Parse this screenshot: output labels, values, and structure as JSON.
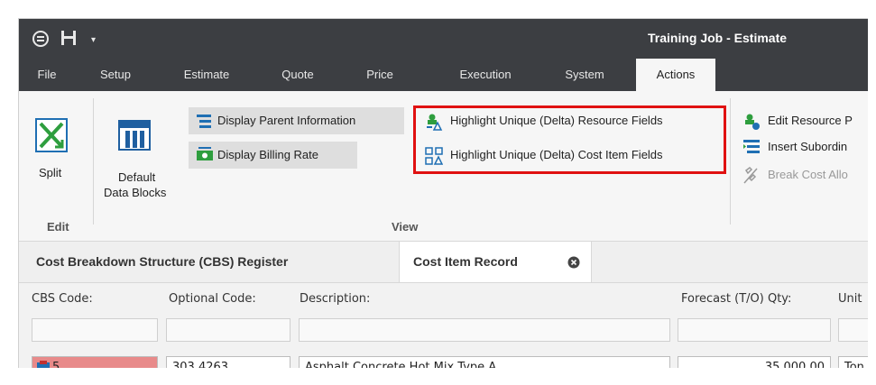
{
  "window": {
    "title": "Training Job - Estimate"
  },
  "menu": [
    "File",
    "Setup",
    "Estimate",
    "Quote",
    "Price",
    "Execution",
    "System",
    "Actions"
  ],
  "ribbon": {
    "edit": {
      "split_label": "Split",
      "group_label": "Edit"
    },
    "view": {
      "default_data_blocks_line1": "Default",
      "default_data_blocks_line2": "Data Blocks",
      "display_parent_info": "Display Parent Information",
      "display_billing_rate": "Display Billing Rate",
      "highlight_resource_fields": "Highlight Unique (Delta) Resource Fields",
      "highlight_cost_item_fields": "Highlight Unique (Delta) Cost Item Fields",
      "group_label": "View"
    },
    "more": {
      "edit_resource": "Edit Resource P",
      "insert_subordinate": "Insert Subordin",
      "break_cost_alloc": "Break Cost Allo"
    }
  },
  "tabs": {
    "cbs_register": "Cost Breakdown Structure (CBS) Register",
    "cost_item_record": "Cost Item Record"
  },
  "form": {
    "headers": {
      "cbs_code": "CBS Code:",
      "optional_code": "Optional Code:",
      "description": "Description:",
      "forecast_qty": "Forecast (T/O) Qty:",
      "unit": "Unit"
    },
    "row": {
      "cbs_code": "5",
      "optional_code": "303.4263",
      "description": "Asphalt Concrete Hot Mix Type A",
      "forecast_qty": "35,000.00",
      "unit": "Ton"
    }
  },
  "colors": {
    "titlebar": "#3c3e42",
    "highlight_box": "#e01111",
    "cbs_cell": "#e88a8a"
  }
}
